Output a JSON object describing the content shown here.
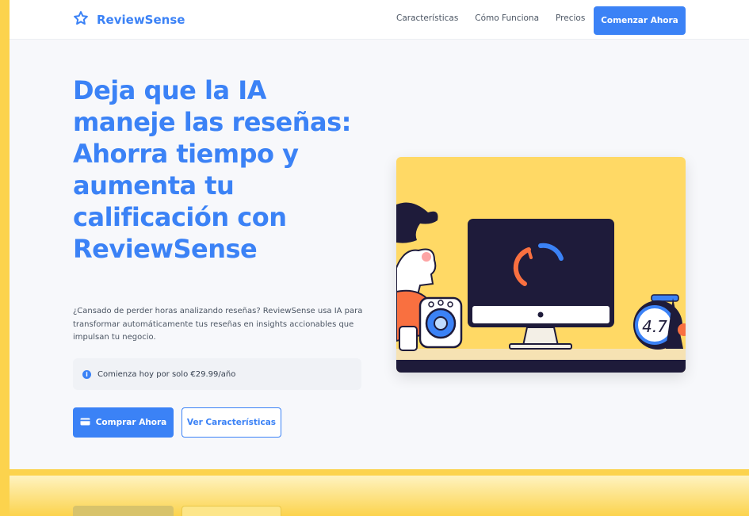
{
  "brand": {
    "name": "ReviewSense",
    "icon": "star-icon"
  },
  "nav": {
    "links": [
      "Características",
      "Cómo Funciona",
      "Precios"
    ],
    "cta": "Comenzar Ahora"
  },
  "hero": {
    "title_lines": [
      "Deja que la IA",
      "maneje las reseñas:",
      "Ahorra tiempo y",
      "aumenta tu",
      "calificación con",
      "ReviewSense"
    ],
    "description": "¿Cansado de perder horas analizando reseñas? ReviewSense usa IA para transformar automáticamente tus reseñas en insights accionables que impulsan tu negocio.",
    "info": "Comienza hoy por solo €29.99/año",
    "buy_button": "Comprar Ahora",
    "features_button": "Ver Características"
  },
  "illustration": {
    "rating": "4.7"
  },
  "colors": {
    "accent": "#3b82f6",
    "frame": "#fcd34d",
    "illustration_bg": "#ffd965"
  }
}
